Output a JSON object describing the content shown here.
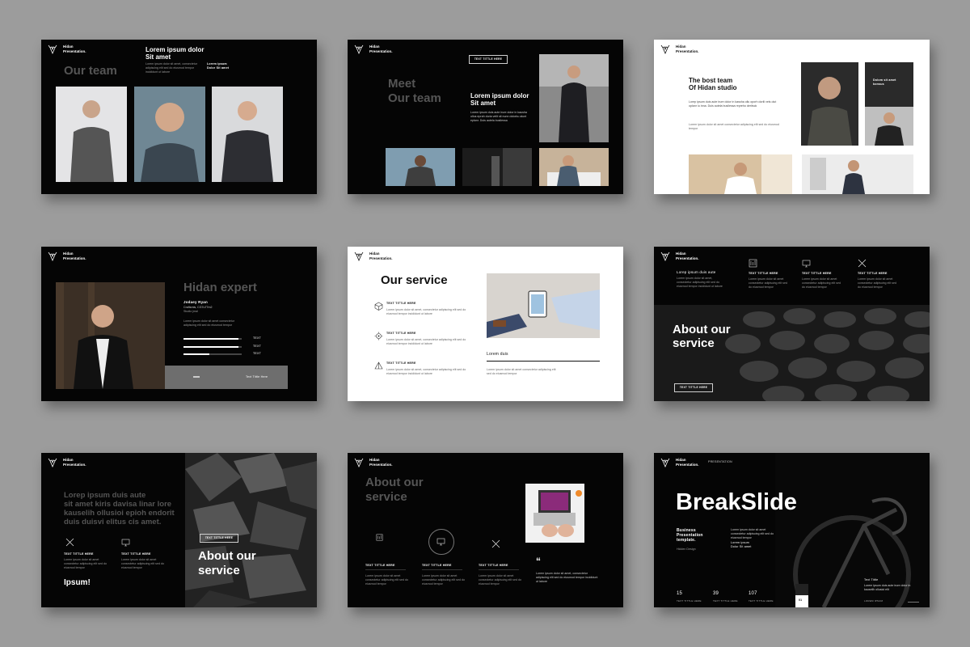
{
  "brand": {
    "line1": "Hidan",
    "line2": "Presentation."
  },
  "lorem_small": "Lorem ipsum dolor sit amet, consectetur adipiscing elit sed do eiusmod tempor incididunt ut labore",
  "lorem_med": "Lorem ipsum dolor sit amet consectetur adipiscing elit sed do eiusmod tempor",
  "s1": {
    "title": "Our team",
    "heading": "Lorem ipsum dolor Sit amet",
    "side": "Lorem ipsum Dolor Sit amet"
  },
  "s2": {
    "title_line1": "Meet",
    "title_line2": "Our team",
    "button": "TEXT TITTLE HERE",
    "heading": "Lorem ipsum dolor Sit amet",
    "body": "Lorem ipsum duis aute irure dolor in kausha ollus eprah duria velit sit nunn dolorku alunt eplanr. Duis autela busilessa"
  },
  "s3": {
    "title_line1": "The bost team",
    "title_line2": "Of Hidan studio",
    "body": "Lorep ipsum duis aute irure dolor in kassha ollu oporh dorili vels olut oplanr lu inna. Duis autela busilessa repreho deritsck",
    "card": "Dolom sit amet konsus"
  },
  "s4": {
    "title": "Hidan expert",
    "name": "Jodaey Ryan",
    "role": "Craftsmis, CG7u77m2",
    "sub": "Studio jmal",
    "bars": [
      "TEXT",
      "TEXT",
      "TEXT"
    ],
    "bars_level": [
      0.95,
      0.95,
      0.45
    ],
    "bottom": "Text Tittle Here"
  },
  "s5": {
    "title": "Our service",
    "items": [
      "TEXT TITTLE HERE",
      "TEXT TITTLE HERE",
      "TEXT TITTLE HERE"
    ],
    "caption": "Lorem duis"
  },
  "s6": {
    "title_line1": "About our",
    "title_line2": "service",
    "intro": "Lorep ipsum duis aute",
    "labels": [
      "TEXT TITTLE HERE",
      "TEXT TITTLE HERE",
      "TEXT TITTLE HERE"
    ],
    "button": "TEXT TITTLE HERE"
  },
  "s7": {
    "quote_lines": [
      "Lorep ipsum duis aute",
      "sit amet kiris davisa linar lore",
      "kauselih ollusioi epioh endorit",
      "duis duisvi elitus cis amet."
    ],
    "labels": [
      "TEXT TITTLE HERE",
      "TEXT TITTLE HERE"
    ],
    "button": "TEXT TITTLE HERE",
    "bottom_left": "Ipsum!",
    "title_line1": "About our",
    "title_line2": "service"
  },
  "s8": {
    "title_line1": "About our",
    "title_line2": "service",
    "labels": [
      "TEXT TITTLE HERE",
      "TEXT TITTLE HERE",
      "TEXT TITTLE HERE"
    ],
    "quote_mark": "“"
  },
  "s9": {
    "tag": "PRESENTATION",
    "title": "BreakSlide",
    "sub_line1": "Business",
    "sub_line2": "Presentation",
    "sub_line3": "template.",
    "small": "Hidden Design",
    "side": "Lorem ipsum Dolor Sit amet",
    "stats": [
      {
        "num": "15",
        "lbl": "TEXT TITTLE HERE"
      },
      {
        "num": "39",
        "lbl": "TEXT TITTLE HERE"
      },
      {
        "num": "107",
        "lbl": "TEXT TITTLE HERE"
      }
    ],
    "right_title": "Text Tittle",
    "right_body": "Lorem ipsum duis aute irure dolor in kauselih ollusioi elit",
    "right_small": "LOREM IPSUM",
    "page": "01"
  },
  "icons": [
    "deer-logo-icon",
    "cube-icon",
    "gear-icon",
    "pyramid-icon",
    "building-icon",
    "monitor-icon",
    "tools-icon"
  ]
}
